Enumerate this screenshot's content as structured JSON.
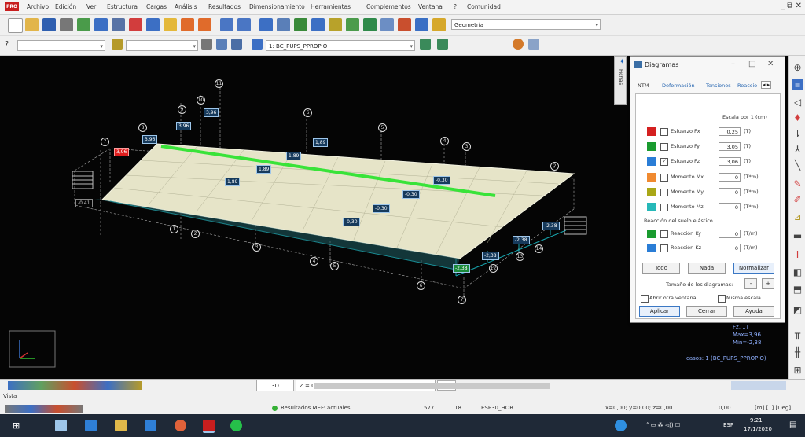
{
  "menu": [
    "Archivo",
    "Edición",
    "Ver",
    "Estructura",
    "Cargas",
    "Análisis",
    "Resultados",
    "Dimensionamiento",
    "Herramientas",
    "Complementos",
    "Ventana",
    "?",
    "Comunidad"
  ],
  "app_badge": "PRO",
  "window_controls": "_ ⧉ ✕",
  "toolbar": {
    "geometry_combo": "Geometría",
    "load_case_combo": "1: BC_PUPS_PPROPIO",
    "help_label": "?"
  },
  "side_tab": {
    "label": "Fichas"
  },
  "dialog": {
    "title": "Diagramas",
    "tabs": [
      "NTM",
      "Deformación",
      "Tensiones",
      "Reaccio"
    ],
    "scale_label": "Escala por 1  (cm)",
    "rows": [
      {
        "label": "Esfuerzo Fx",
        "value": "0,25",
        "unit": "(T)",
        "checked": false,
        "color": "#d42020"
      },
      {
        "label": "Esfuerzo Fy",
        "value": "3,05",
        "unit": "(T)",
        "checked": false,
        "color": "#1a9b2f"
      },
      {
        "label": "Esfuerzo Fz",
        "value": "3,06",
        "unit": "(T)",
        "checked": true,
        "color": "#2a7dd6"
      },
      {
        "label": "Momento Mx",
        "value": "0",
        "unit": "(T*m)",
        "checked": false,
        "color": "#f08a30"
      },
      {
        "label": "Momento My",
        "value": "0",
        "unit": "(T*m)",
        "checked": false,
        "color": "#a9a717"
      },
      {
        "label": "Momento Mz",
        "value": "0",
        "unit": "(T*m)",
        "checked": false,
        "color": "#26b8b8"
      }
    ],
    "soil_section": "Reacción del suelo elástico",
    "soil_rows": [
      {
        "label": "Reacción Ky",
        "value": "0",
        "unit": "(T/m)",
        "color": "#1a9b2f"
      },
      {
        "label": "Reacción Kz",
        "value": "0",
        "unit": "(T/m)",
        "color": "#2a7dd6"
      }
    ],
    "buttons_row1": [
      "Todo",
      "Nada",
      "Normalizar"
    ],
    "diagram_size_label": "Tamaño de los diagramas:",
    "size_minus": "-",
    "size_plus": "+",
    "open_other_window": "Abrir otra ventana",
    "same_scale": "Misma escala",
    "buttons_row2": [
      "Aplicar",
      "Cerrar",
      "Ayuda"
    ]
  },
  "viewport": {
    "legend_lines": [
      "Fz, 1T",
      "Max=3,96",
      "Min=-2,38"
    ],
    "case_label": "casos: 1 (BC_PUPS_PPROPIO)",
    "labels": [
      "3,96",
      "3,96",
      "3,96",
      "3,96",
      "1,89",
      "1,89",
      "1,89",
      "1,89",
      "-0,30",
      "-0,30",
      "-0,30",
      "-0,30",
      "-2,38",
      "-2,38",
      "-2,38",
      "-2,38",
      "-0,41"
    ],
    "nodes": [
      "11",
      "10",
      "9",
      "8",
      "7",
      "6",
      "5",
      "4",
      "3",
      "2",
      "1",
      "2",
      "3",
      "4",
      "5",
      "6",
      "7",
      "12",
      "13",
      "14"
    ]
  },
  "bottom": {
    "view_mode": "3D",
    "level": "Z = 0,00 m - Base",
    "vista": "Vista",
    "results_status": "Resultados MEF: actuales",
    "count1": "577",
    "count2": "18",
    "section": "ESP30_HOR",
    "coords": "x=0,00; y=0,00; z=0,00",
    "value": "0,00",
    "units": "[m] [T] [Deg]"
  },
  "taskbar": {
    "lang": "ESP",
    "time": "9:21",
    "date": "17/1/2020"
  }
}
